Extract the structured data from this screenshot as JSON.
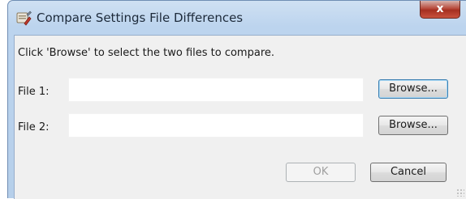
{
  "window": {
    "title": "Compare Settings File Differences",
    "close_label": "x"
  },
  "dialog": {
    "instruction": "Click 'Browse' to select the two files to compare.",
    "file1": {
      "label": "File 1:",
      "value": "",
      "browse_label": "Browse..."
    },
    "file2": {
      "label": "File 2:",
      "value": "",
      "browse_label": "Browse..."
    },
    "ok_label": "OK",
    "cancel_label": "Cancel"
  },
  "colors": {
    "titlebar": "#bcd4ee",
    "close_button": "#b84a3c",
    "client_background": "#f0f0f0",
    "focus_border": "#3c7fb1"
  },
  "icons": {
    "app": "settings-wrench-icon",
    "resize": "resize-grip-icon"
  }
}
